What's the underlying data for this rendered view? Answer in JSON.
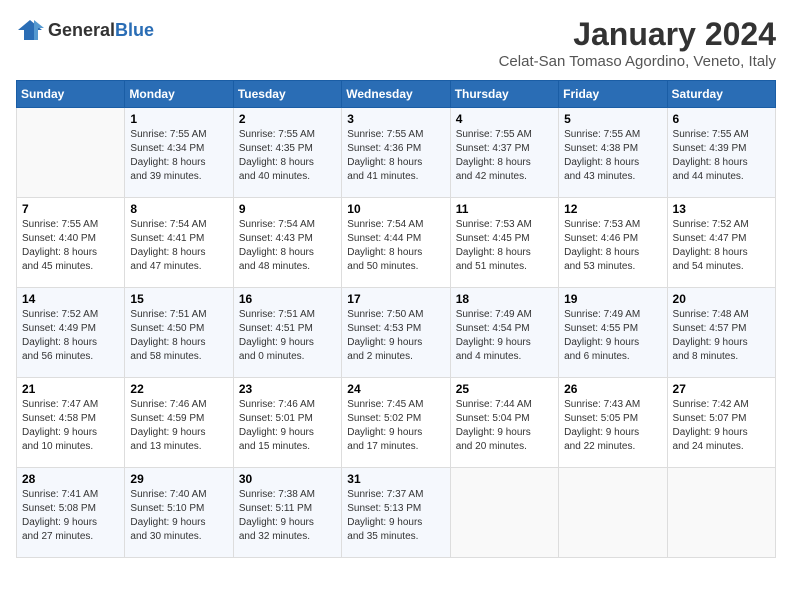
{
  "header": {
    "logo_general": "General",
    "logo_blue": "Blue",
    "month_title": "January 2024",
    "location": "Celat-San Tomaso Agordino, Veneto, Italy"
  },
  "weekdays": [
    "Sunday",
    "Monday",
    "Tuesday",
    "Wednesday",
    "Thursday",
    "Friday",
    "Saturday"
  ],
  "weeks": [
    [
      {
        "day": "",
        "info": ""
      },
      {
        "day": "1",
        "info": "Sunrise: 7:55 AM\nSunset: 4:34 PM\nDaylight: 8 hours\nand 39 minutes."
      },
      {
        "day": "2",
        "info": "Sunrise: 7:55 AM\nSunset: 4:35 PM\nDaylight: 8 hours\nand 40 minutes."
      },
      {
        "day": "3",
        "info": "Sunrise: 7:55 AM\nSunset: 4:36 PM\nDaylight: 8 hours\nand 41 minutes."
      },
      {
        "day": "4",
        "info": "Sunrise: 7:55 AM\nSunset: 4:37 PM\nDaylight: 8 hours\nand 42 minutes."
      },
      {
        "day": "5",
        "info": "Sunrise: 7:55 AM\nSunset: 4:38 PM\nDaylight: 8 hours\nand 43 minutes."
      },
      {
        "day": "6",
        "info": "Sunrise: 7:55 AM\nSunset: 4:39 PM\nDaylight: 8 hours\nand 44 minutes."
      }
    ],
    [
      {
        "day": "7",
        "info": "Sunrise: 7:55 AM\nSunset: 4:40 PM\nDaylight: 8 hours\nand 45 minutes."
      },
      {
        "day": "8",
        "info": "Sunrise: 7:54 AM\nSunset: 4:41 PM\nDaylight: 8 hours\nand 47 minutes."
      },
      {
        "day": "9",
        "info": "Sunrise: 7:54 AM\nSunset: 4:43 PM\nDaylight: 8 hours\nand 48 minutes."
      },
      {
        "day": "10",
        "info": "Sunrise: 7:54 AM\nSunset: 4:44 PM\nDaylight: 8 hours\nand 50 minutes."
      },
      {
        "day": "11",
        "info": "Sunrise: 7:53 AM\nSunset: 4:45 PM\nDaylight: 8 hours\nand 51 minutes."
      },
      {
        "day": "12",
        "info": "Sunrise: 7:53 AM\nSunset: 4:46 PM\nDaylight: 8 hours\nand 53 minutes."
      },
      {
        "day": "13",
        "info": "Sunrise: 7:52 AM\nSunset: 4:47 PM\nDaylight: 8 hours\nand 54 minutes."
      }
    ],
    [
      {
        "day": "14",
        "info": "Sunrise: 7:52 AM\nSunset: 4:49 PM\nDaylight: 8 hours\nand 56 minutes."
      },
      {
        "day": "15",
        "info": "Sunrise: 7:51 AM\nSunset: 4:50 PM\nDaylight: 8 hours\nand 58 minutes."
      },
      {
        "day": "16",
        "info": "Sunrise: 7:51 AM\nSunset: 4:51 PM\nDaylight: 9 hours\nand 0 minutes."
      },
      {
        "day": "17",
        "info": "Sunrise: 7:50 AM\nSunset: 4:53 PM\nDaylight: 9 hours\nand 2 minutes."
      },
      {
        "day": "18",
        "info": "Sunrise: 7:49 AM\nSunset: 4:54 PM\nDaylight: 9 hours\nand 4 minutes."
      },
      {
        "day": "19",
        "info": "Sunrise: 7:49 AM\nSunset: 4:55 PM\nDaylight: 9 hours\nand 6 minutes."
      },
      {
        "day": "20",
        "info": "Sunrise: 7:48 AM\nSunset: 4:57 PM\nDaylight: 9 hours\nand 8 minutes."
      }
    ],
    [
      {
        "day": "21",
        "info": "Sunrise: 7:47 AM\nSunset: 4:58 PM\nDaylight: 9 hours\nand 10 minutes."
      },
      {
        "day": "22",
        "info": "Sunrise: 7:46 AM\nSunset: 4:59 PM\nDaylight: 9 hours\nand 13 minutes."
      },
      {
        "day": "23",
        "info": "Sunrise: 7:46 AM\nSunset: 5:01 PM\nDaylight: 9 hours\nand 15 minutes."
      },
      {
        "day": "24",
        "info": "Sunrise: 7:45 AM\nSunset: 5:02 PM\nDaylight: 9 hours\nand 17 minutes."
      },
      {
        "day": "25",
        "info": "Sunrise: 7:44 AM\nSunset: 5:04 PM\nDaylight: 9 hours\nand 20 minutes."
      },
      {
        "day": "26",
        "info": "Sunrise: 7:43 AM\nSunset: 5:05 PM\nDaylight: 9 hours\nand 22 minutes."
      },
      {
        "day": "27",
        "info": "Sunrise: 7:42 AM\nSunset: 5:07 PM\nDaylight: 9 hours\nand 24 minutes."
      }
    ],
    [
      {
        "day": "28",
        "info": "Sunrise: 7:41 AM\nSunset: 5:08 PM\nDaylight: 9 hours\nand 27 minutes."
      },
      {
        "day": "29",
        "info": "Sunrise: 7:40 AM\nSunset: 5:10 PM\nDaylight: 9 hours\nand 30 minutes."
      },
      {
        "day": "30",
        "info": "Sunrise: 7:38 AM\nSunset: 5:11 PM\nDaylight: 9 hours\nand 32 minutes."
      },
      {
        "day": "31",
        "info": "Sunrise: 7:37 AM\nSunset: 5:13 PM\nDaylight: 9 hours\nand 35 minutes."
      },
      {
        "day": "",
        "info": ""
      },
      {
        "day": "",
        "info": ""
      },
      {
        "day": "",
        "info": ""
      }
    ]
  ]
}
